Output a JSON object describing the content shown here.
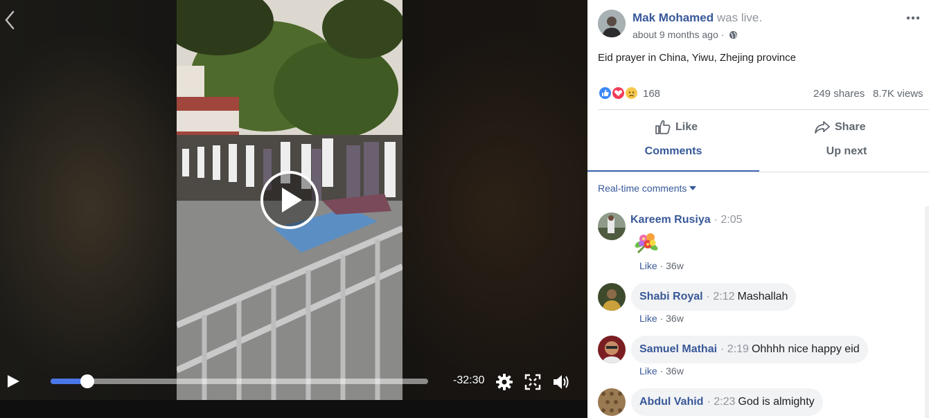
{
  "player": {
    "time_remaining": "-32:30",
    "progress": 0.098,
    "icons": [
      "chevron-left-icon",
      "play-icon",
      "gear-icon",
      "fullscreen-icon",
      "volume-icon"
    ]
  },
  "post": {
    "author": "Mak Mohamed",
    "status": "was live.",
    "time": "about 9 months ago",
    "separator": "·",
    "text": "Eid prayer in China, Yiwu, Zhejing province",
    "reaction_count": "168",
    "shares": "249 shares",
    "views": "8.7K views"
  },
  "actions": {
    "like": "Like",
    "share": "Share"
  },
  "tabs": [
    {
      "label": "Comments",
      "active": true
    },
    {
      "label": "Up next",
      "active": false
    }
  ],
  "comments_filter": "Real-time comments",
  "comments": [
    {
      "name": "Kareem Rusiya",
      "time": "· 2:05",
      "text": "",
      "like": "Like",
      "age": "· 36w"
    },
    {
      "name": "Shabi Royal",
      "time": "· 2:12",
      "text": "Mashallah",
      "like": "Like",
      "age": "· 36w"
    },
    {
      "name": "Samuel Mathai",
      "time": "· 2:19",
      "text": "Ohhhh nice happy eid",
      "like": "Like",
      "age": "· 36w"
    },
    {
      "name": "Abdul Vahid",
      "time": "· 2:23",
      "text": "God is almighty"
    }
  ],
  "colors": {
    "link": "#365899",
    "accent": "#4267b2",
    "progress": "#4a76e8",
    "muted": "#606770",
    "bubble": "#f2f3f5"
  }
}
